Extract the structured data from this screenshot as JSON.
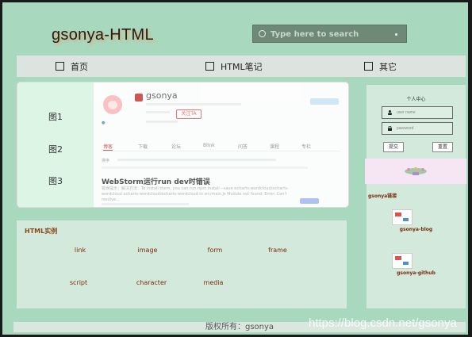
{
  "header": {
    "brand": "gsonya-HTML",
    "search_placeholder": "Type here to search"
  },
  "nav": {
    "items": [
      {
        "label": "首页"
      },
      {
        "label": "HTML笔记"
      },
      {
        "label": "其它"
      }
    ]
  },
  "gallery": {
    "items": [
      {
        "label": "图1"
      },
      {
        "label": "图2"
      },
      {
        "label": "图3"
      }
    ],
    "preview": {
      "profile_name": "gsonya",
      "follow_label": "关注TA",
      "tabs": [
        "博客",
        "下载",
        "论坛",
        "Blink",
        "问答",
        "课程",
        "专栏"
      ],
      "row_text": "排序",
      "article_title": "WebStorm运行run dev时错误",
      "excerpt": "错误提示：解决方法：To install them, you can run npm install --save echarts-wordcloud/echarts-wordcloud echarts-wordcloud/echarts-wordcloud in src/main.js  Module not found: Error: Can't resolve..."
    }
  },
  "examples": {
    "title": "HTML实例",
    "items": [
      {
        "label": "link"
      },
      {
        "label": "image"
      },
      {
        "label": "form"
      },
      {
        "label": "frame"
      },
      {
        "label": "script"
      },
      {
        "label": "character"
      },
      {
        "label": "media"
      }
    ]
  },
  "user_center": {
    "title": "个人中心",
    "username_placeholder": "user name",
    "password_placeholder": "password",
    "submit_label": "提交",
    "reset_label": "重置"
  },
  "links": {
    "title": "gsonya链接",
    "items": [
      {
        "label": "gsonya-blog"
      },
      {
        "label": "gsonya-github"
      }
    ]
  },
  "footer": {
    "copyright": "版权所有：gsonya"
  },
  "watermark": "https://blog.csdn.net/gsonya"
}
